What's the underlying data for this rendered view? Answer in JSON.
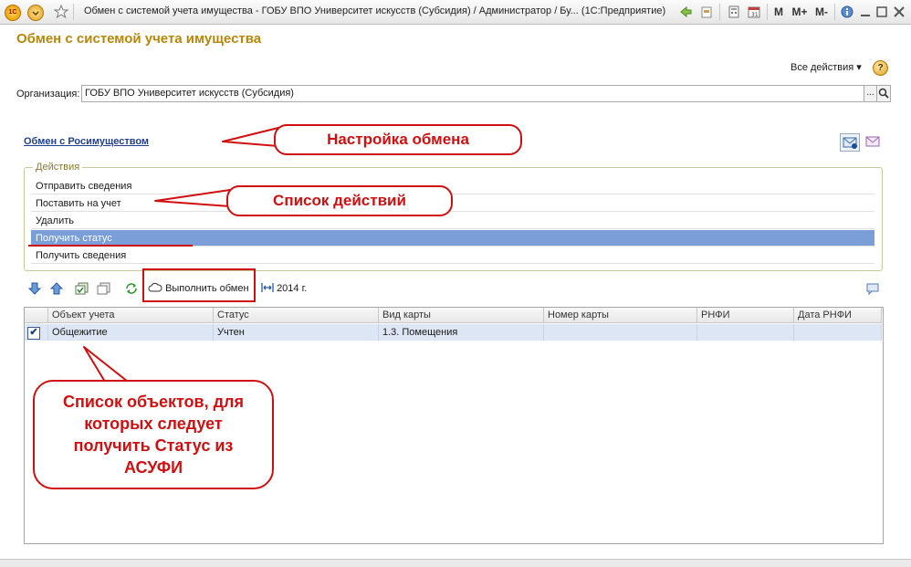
{
  "window": {
    "title": "Обмен с системой учета имущества - ГОБУ ВПО Университет искусств (Субсидия) / Администратор / Бу... (1С:Предприятие)",
    "buttons": {
      "m": "M",
      "m_plus": "M+",
      "m_minus": "M-"
    }
  },
  "form": {
    "title": "Обмен с системой учета имущества",
    "all_actions": "Все действия ▾",
    "help": "?"
  },
  "organization": {
    "label": "Организация:",
    "value": "ГОБУ ВПО Университет искусств (Субсидия)",
    "dots": "..."
  },
  "exchange": {
    "link": "Обмен с Росимуществом"
  },
  "actions": {
    "legend": "Действия",
    "items": [
      "Отправить сведения",
      "Поставить на учет",
      "Удалить",
      "Получить статус",
      "Получить сведения"
    ],
    "selected": 3
  },
  "toolbar": {
    "run_exchange": "Выполнить обмен",
    "year": "2014 г."
  },
  "table": {
    "columns": [
      "Объект учета",
      "Статус",
      "Вид карты",
      "Номер карты",
      "РНФИ",
      "Дата РНФИ"
    ],
    "rows": [
      {
        "object": "Общежитие",
        "status": "Учтен",
        "card_type": "1.3. Помещения",
        "card_number": "",
        "rnfi": "",
        "rnfi_date": ""
      }
    ]
  },
  "callouts": {
    "exchange_setup": "Настройка обмена",
    "action_list": "Список действий",
    "object_list": "Список объектов, для которых следует получить Статус из АСУФИ"
  },
  "colors": {
    "accent": "#b8860b",
    "selection": "#7a9fd8",
    "callout": "#d01010"
  }
}
